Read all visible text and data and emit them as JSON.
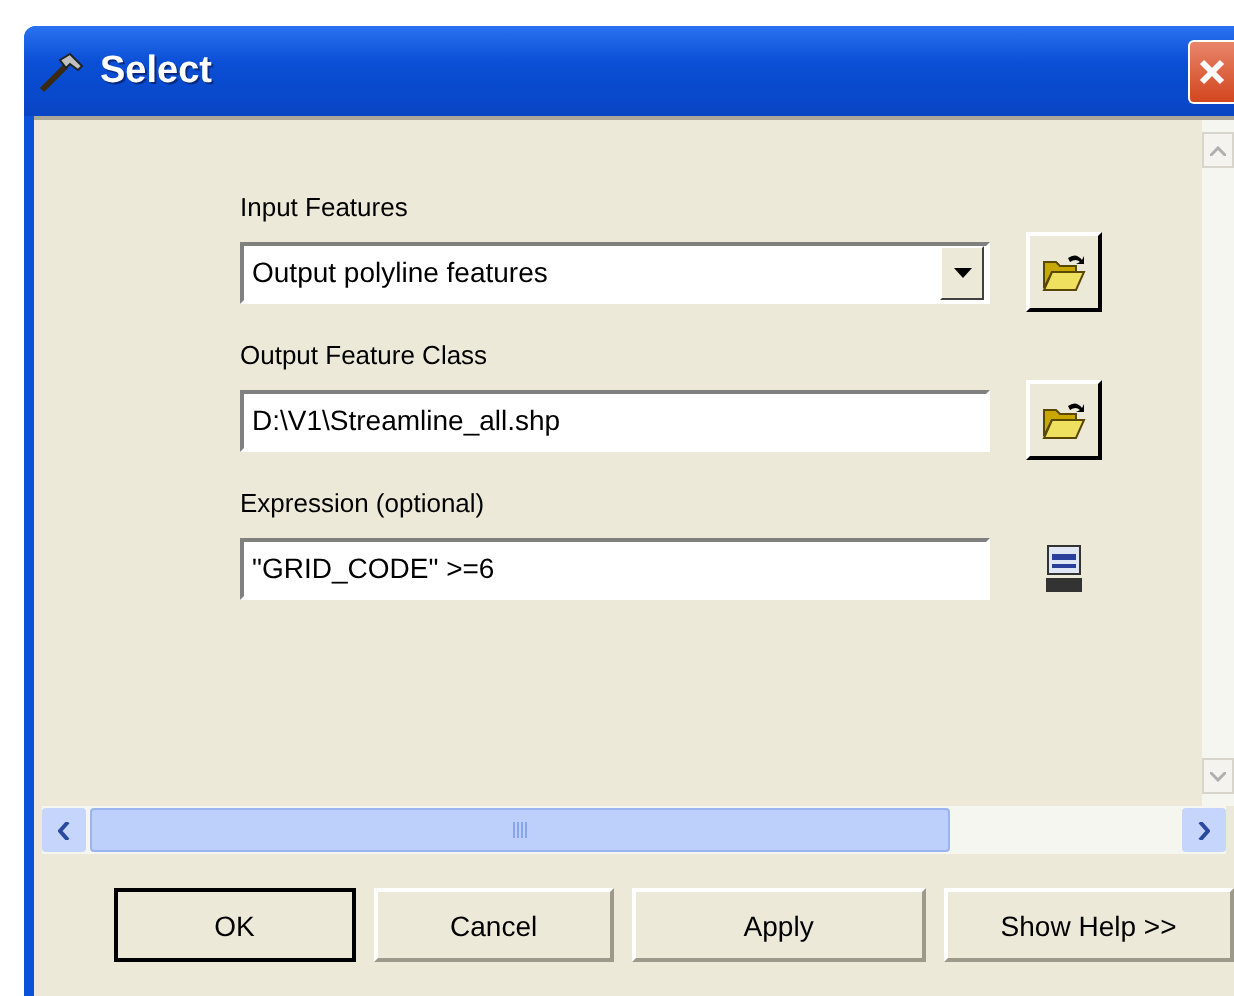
{
  "window": {
    "title": "Select"
  },
  "fields": [
    {
      "kind": "dropdown",
      "label": "Input Features",
      "value": "Output polyline features",
      "button": {
        "kind": "browse"
      }
    },
    {
      "kind": "text",
      "label": "Output Feature Class",
      "value": "D:\\V1\\Streamline_all.shp",
      "button": {
        "kind": "browse"
      }
    },
    {
      "kind": "text",
      "label": "Expression (optional)",
      "value": "\"GRID_CODE\" >=6",
      "button": {
        "kind": "sql"
      }
    }
  ],
  "buttons": [
    {
      "label": "OK",
      "default": true
    },
    {
      "label": "Cancel",
      "default": false
    },
    {
      "label": "Apply",
      "default": false
    },
    {
      "label": "Show Help >>",
      "default": false
    }
  ]
}
